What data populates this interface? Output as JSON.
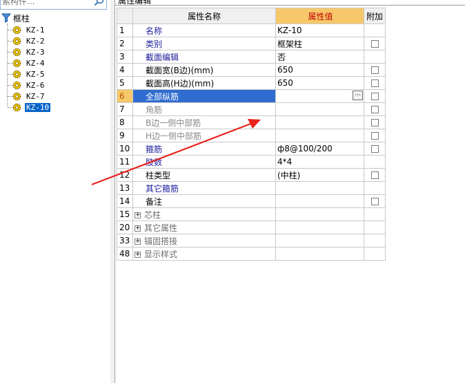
{
  "search": {
    "placeholder": "索构件..."
  },
  "tree": {
    "root_label": "框柱",
    "items": [
      "KZ-1",
      "KZ-2",
      "KZ-3",
      "KZ-4",
      "KZ-5",
      "KZ-6",
      "KZ-7",
      "KZ-10"
    ],
    "selected": "KZ-10"
  },
  "panel": {
    "title": "属性编辑"
  },
  "grid": {
    "headers": {
      "name": "属性名称",
      "value": "属性值",
      "add": "附加"
    },
    "rows": [
      {
        "num": "1",
        "name": "名称",
        "value": "KZ-10",
        "style": "blue",
        "check": false
      },
      {
        "num": "2",
        "name": "类别",
        "value": "框架柱",
        "style": "blue",
        "check": true
      },
      {
        "num": "3",
        "name": "截面编辑",
        "value": "否",
        "style": "blue",
        "check": false
      },
      {
        "num": "4",
        "name": "截面宽(B边)(mm)",
        "value": "650",
        "style": "black",
        "check": true
      },
      {
        "num": "5",
        "name": "截面高(H边)(mm)",
        "value": "650",
        "style": "black",
        "check": true
      },
      {
        "num": "6",
        "name": "全部纵筋",
        "value": "",
        "style": "selected",
        "check": true
      },
      {
        "num": "7",
        "name": "角筋",
        "value": "",
        "style": "gray",
        "check": true
      },
      {
        "num": "8",
        "name": "B边一侧中部筋",
        "value": "",
        "style": "gray",
        "check": true
      },
      {
        "num": "9",
        "name": "H边一侧中部筋",
        "value": "",
        "style": "gray",
        "check": true
      },
      {
        "num": "10",
        "name": "箍筋",
        "value": "ф8@100/200",
        "style": "blue",
        "check": true
      },
      {
        "num": "11",
        "name": "肢数",
        "value": "4*4",
        "style": "blue",
        "check": false
      },
      {
        "num": "12",
        "name": "柱类型",
        "value": "(中柱)",
        "style": "black",
        "check": true
      },
      {
        "num": "13",
        "name": "其它箍筋",
        "value": "",
        "style": "blue",
        "check": false
      },
      {
        "num": "14",
        "name": "备注",
        "value": "",
        "style": "black",
        "check": true
      },
      {
        "num": "15",
        "name": "芯柱",
        "value": "",
        "style": "group",
        "check": false
      },
      {
        "num": "20",
        "name": "其它属性",
        "value": "",
        "style": "group",
        "check": false
      },
      {
        "num": "33",
        "name": "锚固搭接",
        "value": "",
        "style": "group",
        "check": false
      },
      {
        "num": "48",
        "name": "显示样式",
        "value": "",
        "style": "group",
        "check": false
      }
    ]
  },
  "colors": {
    "arrow": "#e8231e",
    "selected_name_bg": "#2f6cd0",
    "header_value_bg": "#f7c86a"
  },
  "icons": {
    "search": "magnifier-icon",
    "root": "filter-funnel-icon",
    "item": "gear-icon",
    "ellipsis": "ellipsis-icon",
    "expand": "plus-box-icon"
  }
}
